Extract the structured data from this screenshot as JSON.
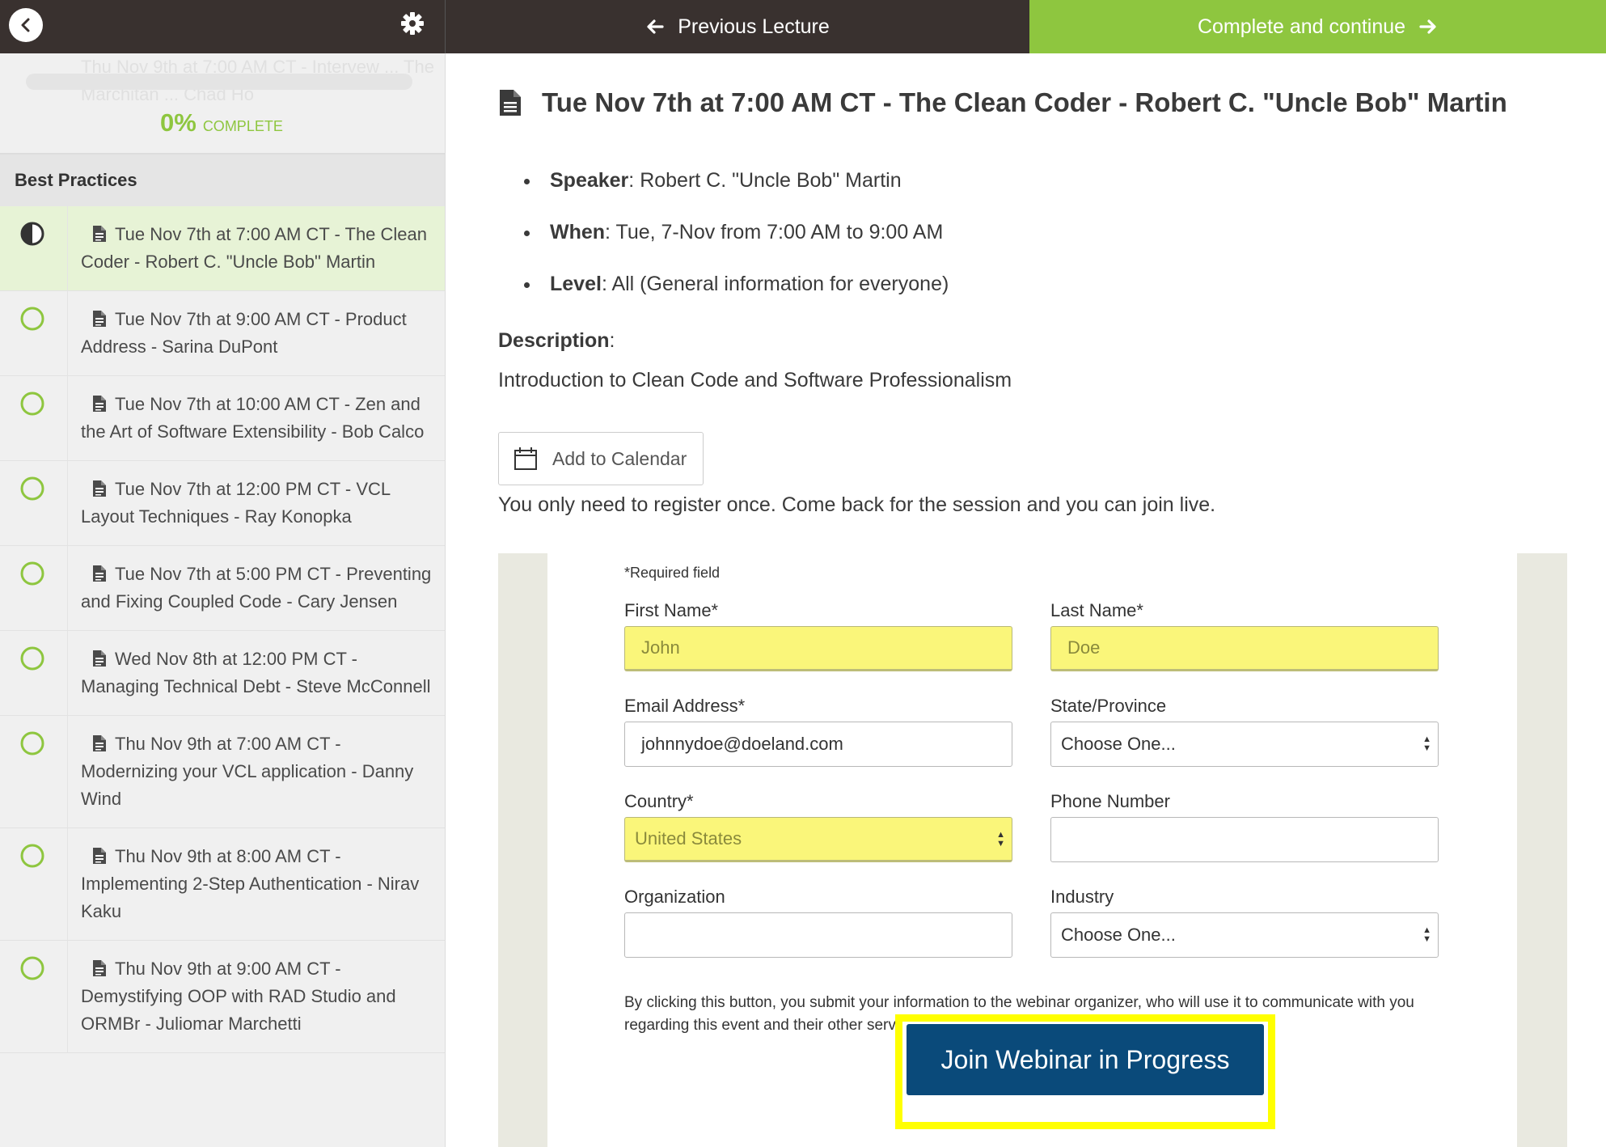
{
  "topbar": {
    "prev_label": "Previous Lecture",
    "next_label": "Complete and continue",
    "accent": "#8ec63f"
  },
  "sidebar": {
    "ghost_text": "Thu Nov 9th at 7:00 AM CT - Intervew ... The Marchitan ... Chad Ho",
    "progress_percent": "0%",
    "progress_word": "COMPLETE",
    "progress_value": 0,
    "section_title": "Best Practices",
    "items": [
      {
        "label": "Tue Nov 7th at 7:00 AM CT - The Clean Coder - Robert C. \"Uncle Bob\" Martin",
        "status": "in-progress"
      },
      {
        "label": "Tue Nov 7th at 9:00 AM CT - Product Address - Sarina DuPont",
        "status": "not-started"
      },
      {
        "label": "Tue Nov 7th at 10:00 AM CT - Zen and the Art of Software Extensibility - Bob Calco",
        "status": "not-started"
      },
      {
        "label": "Tue Nov 7th at 12:00 PM CT - VCL Layout Techniques - Ray Konopka",
        "status": "not-started"
      },
      {
        "label": "Tue Nov 7th at 5:00 PM CT - Preventing and Fixing Coupled Code - Cary Jensen",
        "status": "not-started"
      },
      {
        "label": "Wed Nov 8th at 12:00 PM CT - Managing Technical Debt - Steve McConnell",
        "status": "not-started"
      },
      {
        "label": "Thu Nov 9th at 7:00 AM CT - Modernizing your VCL application - Danny Wind",
        "status": "not-started"
      },
      {
        "label": "Thu Nov 9th at 8:00 AM CT - Implementing 2-Step Authentication - Nirav Kaku",
        "status": "not-started"
      },
      {
        "label": "Thu Nov 9th at 9:00 AM CT - Demystifying OOP with RAD Studio and ORMBr - Juliomar Marchetti",
        "status": "not-started"
      }
    ]
  },
  "lecture": {
    "title": "Tue Nov 7th at 7:00 AM CT - The Clean Coder - Robert C. \"Uncle Bob\" Martin",
    "speaker_key": "Speaker",
    "speaker_value": ": Robert C. \"Uncle Bob\" Martin",
    "when_key": "When",
    "when_value": ": Tue, 7-Nov from 7:00 AM to 9:00 AM",
    "level_key": "Level",
    "level_value": ": All (General information for everyone)",
    "description_key": "Description",
    "description_suffix": ":",
    "description_text": "Introduction to Clean Code and Software Professionalism",
    "calendar_label": "Add to Calendar",
    "register_note": "You only need to register once. Come back for the session and you can join live."
  },
  "form": {
    "required_note": "*Required field",
    "first_name_label": "First Name*",
    "first_name_value": "John",
    "last_name_label": "Last Name*",
    "last_name_value": "Doe",
    "email_label": "Email Address*",
    "email_value": "johnnydoe@doeland.com",
    "state_label": "State/Province",
    "state_value": "Choose One...",
    "country_label": "Country*",
    "country_value": "United States",
    "phone_label": "Phone Number",
    "phone_value": "",
    "org_label": "Organization",
    "org_value": "",
    "industry_label": "Industry",
    "industry_value": "Choose One...",
    "fineprint": "By clicking this button, you submit your information to the webinar organizer, who will use it to communicate with you regarding this event and their other services.",
    "join_label": "Join Webinar in Progress",
    "join_color": "#0a4a7a",
    "highlight_color": "#ffff00",
    "autofill_color": "#faf67a"
  }
}
